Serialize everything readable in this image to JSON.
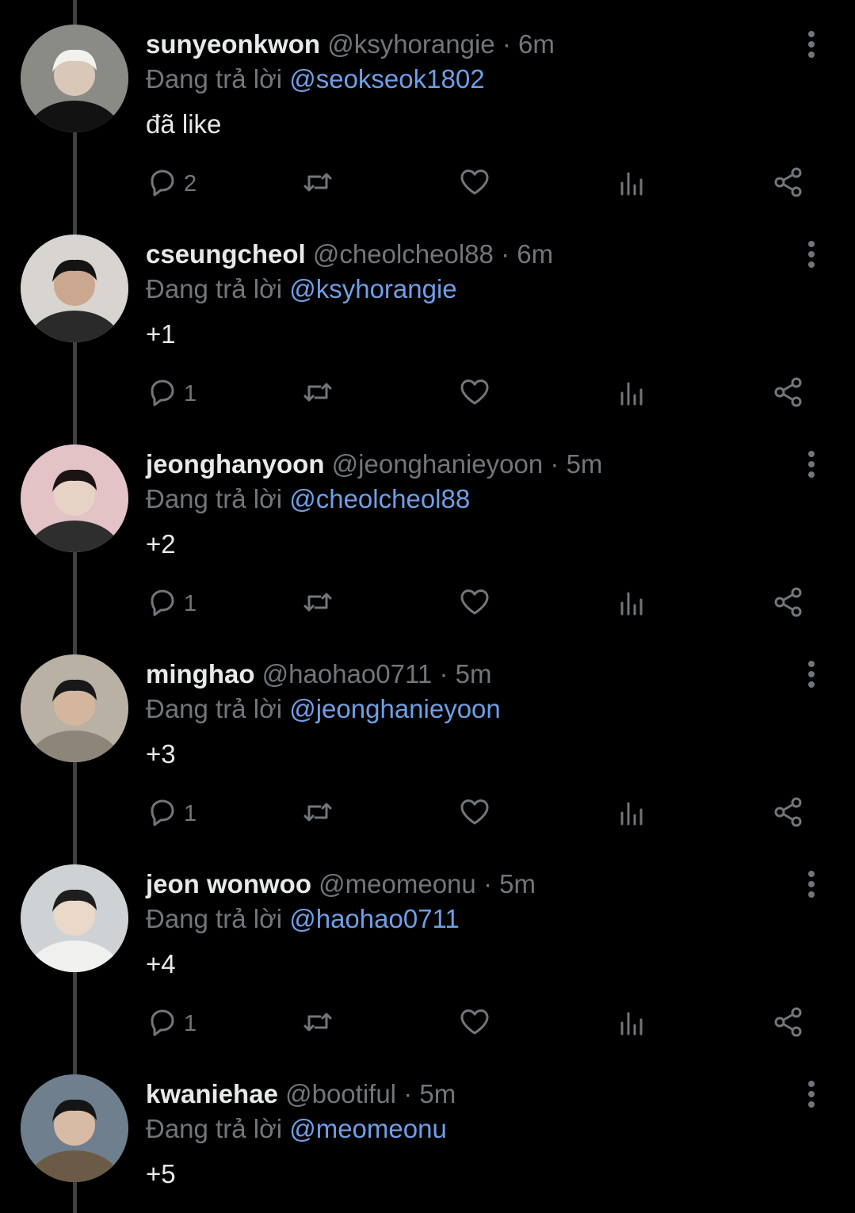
{
  "reply_prefix": "Đang trả lời",
  "separator": "·",
  "colors": {
    "background": "#000000",
    "primary_text": "#e7e9ea",
    "secondary_text": "#71767b",
    "mention": "#6f9fe6",
    "thread_line": "#3e4144"
  },
  "icons": {
    "reply": "speech-bubble-icon",
    "retweet": "retweet-icon",
    "like": "heart-icon",
    "views": "bar-chart-icon",
    "share": "share-icon",
    "more": "vertical-dots-icon"
  },
  "tweets": [
    {
      "name": "sunyeonkwon",
      "handle": "@ksyhorangie",
      "time": "6m",
      "reply_to": "@seokseok1802",
      "text": "đã like",
      "replies": "2"
    },
    {
      "name": "cseungcheol",
      "handle": "@cheolcheol88",
      "time": "6m",
      "reply_to": "@ksyhorangie",
      "text": "+1",
      "replies": "1"
    },
    {
      "name": "jeonghanyoon",
      "handle": "@jeonghanieyoon",
      "time": "5m",
      "reply_to": "@cheolcheol88",
      "text": "+2",
      "replies": "1"
    },
    {
      "name": "minghao",
      "handle": "@haohao0711",
      "time": "5m",
      "reply_to": "@jeonghanieyoon",
      "text": "+3",
      "replies": "1"
    },
    {
      "name": "jeon wonwoo",
      "handle": "@meomeonu",
      "time": "5m",
      "reply_to": "@haohao0711",
      "text": "+4",
      "replies": "1"
    },
    {
      "name": "kwaniehae",
      "handle": "@bootiful",
      "time": "5m",
      "reply_to": "@meomeonu",
      "text": "+5",
      "replies": ""
    }
  ]
}
